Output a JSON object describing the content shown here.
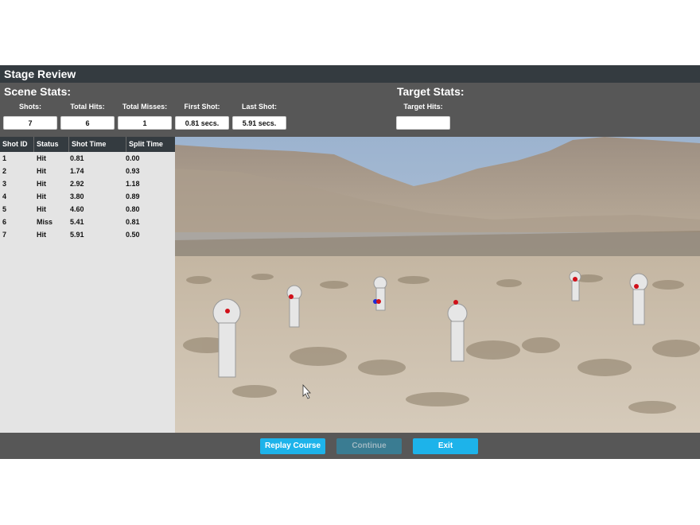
{
  "window": {
    "title": "Stage Review"
  },
  "scene_stats": {
    "title": "Scene Stats:",
    "shots": {
      "label": "Shots:",
      "value": "7"
    },
    "total_hits": {
      "label": "Total Hits:",
      "value": "6"
    },
    "total_misses": {
      "label": "Total Misses:",
      "value": "1"
    },
    "first_shot": {
      "label": "First Shot:",
      "value": "0.81 secs."
    },
    "last_shot": {
      "label": "Last Shot:",
      "value": "5.91 secs."
    }
  },
  "target_stats": {
    "title": "Target Stats:",
    "target_hits": {
      "label": "Target Hits:",
      "value": ""
    }
  },
  "shot_table": {
    "headers": [
      "Shot ID",
      "Status",
      "Shot Time",
      "Split Time"
    ],
    "rows": [
      [
        "1",
        "Hit",
        "0.81",
        "0.00"
      ],
      [
        "2",
        "Hit",
        "1.74",
        "0.93"
      ],
      [
        "3",
        "Hit",
        "2.92",
        "1.18"
      ],
      [
        "4",
        "Hit",
        "3.80",
        "0.89"
      ],
      [
        "5",
        "Hit",
        "4.60",
        "0.80"
      ],
      [
        "6",
        "Miss",
        "5.41",
        "0.81"
      ],
      [
        "7",
        "Hit",
        "5.91",
        "0.50"
      ]
    ]
  },
  "footer": {
    "replay_label": "Replay Course",
    "continue_label": "Continue",
    "exit_label": "Exit"
  },
  "colors": {
    "title_bar": "#343b40",
    "panel": "#575757",
    "button_active": "#1db3ea",
    "button_disabled": "#3a7c92",
    "hit_marker": "#d0101a",
    "miss_marker": "#1a2bd8"
  }
}
